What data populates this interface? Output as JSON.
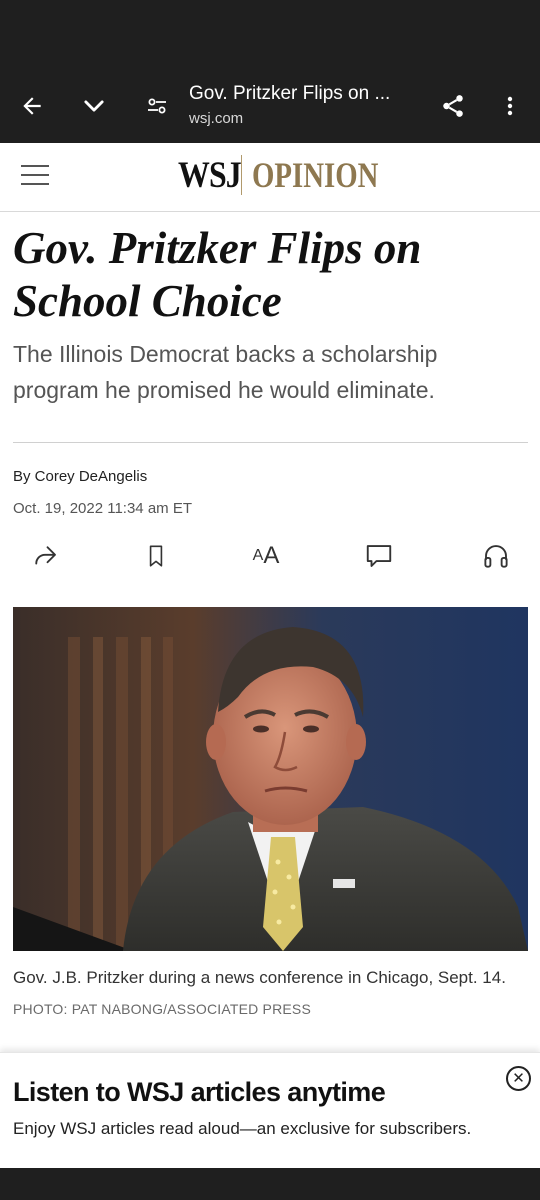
{
  "browser": {
    "page_title": "Gov. Pritzker Flips on ...",
    "domain": "wsj.com",
    "icons": [
      "back-arrow-icon",
      "chevron-down-icon",
      "site-settings-icon",
      "share-icon",
      "more-vert-icon"
    ]
  },
  "header": {
    "logo_wsj": "WSJ",
    "logo_section": "OPINION",
    "colors": {
      "opinion_gold": "#8e7850"
    }
  },
  "article": {
    "headline": "Gov. Pritzker Flips on School Choice",
    "dek": "The Illinois Democrat backs a scholarship program he promised he would eliminate.",
    "byline": "By Corey DeAngelis",
    "timestamp": "Oct. 19, 2022 11:34 am ET",
    "tools": {
      "text_size_glyph_small": "A",
      "text_size_glyph_big": "A",
      "icons": [
        "share-arrow-icon",
        "bookmark-icon",
        "text-size-icon",
        "comment-icon",
        "headphones-icon"
      ]
    },
    "photo": {
      "caption": "Gov. J.B. Pritzker during a news conference in Chicago, Sept. 14.",
      "credit": "PHOTO: PAT NABONG/ASSOCIATED PRESS"
    }
  },
  "promo": {
    "title": "Listen to WSJ articles anytime",
    "subtitle": "Enjoy WSJ articles read aloud—an exclusive for subscribers.",
    "close_glyph": "✕"
  }
}
